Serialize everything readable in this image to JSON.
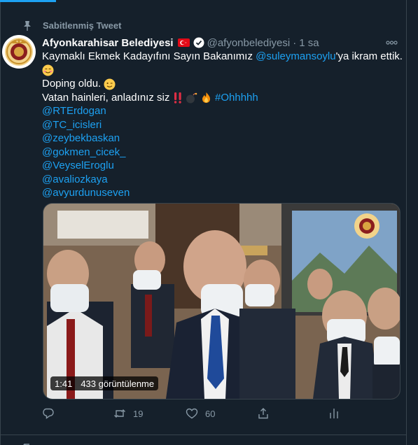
{
  "pinned": {
    "label": "Sabitlenmiş Tweet"
  },
  "tweet": {
    "author": {
      "name": "Afyonkarahisar Belediyesi",
      "handle": "@afyonbelediyesi",
      "time": "1 sa"
    },
    "line1": {
      "text_before": "Kaymaklı Ekmek Kadayıfını Sayın Bakanımız ",
      "mention": "@suleymansoylu",
      "text_after": "'ya ikram ettik."
    },
    "line3": {
      "text": "Doping oldu."
    },
    "line4": {
      "text": "Vatan hainleri, anladınız siz ",
      "hashtag": "#Ohhhhh"
    },
    "mentions": [
      "@RTErdogan",
      "@TC_icisleri",
      "@zeybekbaskan",
      "@gokmen_cicek_",
      "@VeyselEroglu",
      "@avaliozkaya",
      "@avyurdunuseven"
    ]
  },
  "media": {
    "duration": "1:41",
    "views": "433 görüntülenme"
  },
  "actions": {
    "reply_count": "",
    "retweet_count": "19",
    "like_count": "60"
  },
  "icons": {
    "pin": "pin-icon",
    "verified": "verified-badge-icon",
    "flag": "turkey-flag-icon",
    "more": "more-icon",
    "reply": "reply-icon",
    "retweet": "retweet-icon",
    "like": "heart-icon",
    "share": "share-icon",
    "analytics": "analytics-icon"
  },
  "colors": {
    "background": "#15202b",
    "accent": "#1da1f2",
    "muted": "#8899a6",
    "text": "#ffffff"
  }
}
